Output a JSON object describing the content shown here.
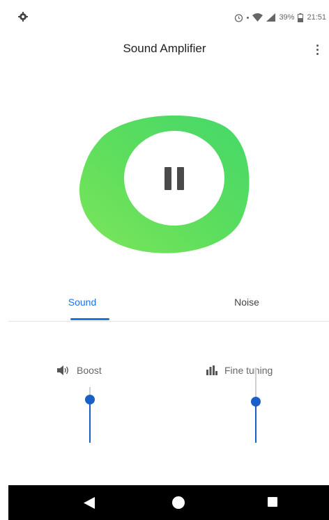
{
  "status_bar": {
    "battery_text": "39%",
    "time": "21:51",
    "icons": [
      "settings-gear-icon",
      "alarm-icon",
      "wifi-icon",
      "signal-icon",
      "battery-icon"
    ]
  },
  "app_bar": {
    "title": "Sound Amplifier",
    "menu_icon": "more-vert-icon"
  },
  "main": {
    "toggle_icon": "pause-icon",
    "accent_color": "#5ee05e"
  },
  "tabs": [
    {
      "label": "Sound",
      "selected": true
    },
    {
      "label": "Noise",
      "selected": false
    }
  ],
  "sliders": {
    "boost": {
      "label": "Boost",
      "icon": "volume-icon",
      "level": 0.78
    },
    "fine_tuning": {
      "label": "Fine tuning",
      "icon": "equalizer-icon",
      "level": 0.55
    }
  },
  "nav_bar": {
    "buttons": [
      "back-icon",
      "home-icon",
      "recents-icon"
    ]
  },
  "colors": {
    "primary": "#1a73e8",
    "slider": "#1a5fc8",
    "nav_background": "#000000"
  }
}
